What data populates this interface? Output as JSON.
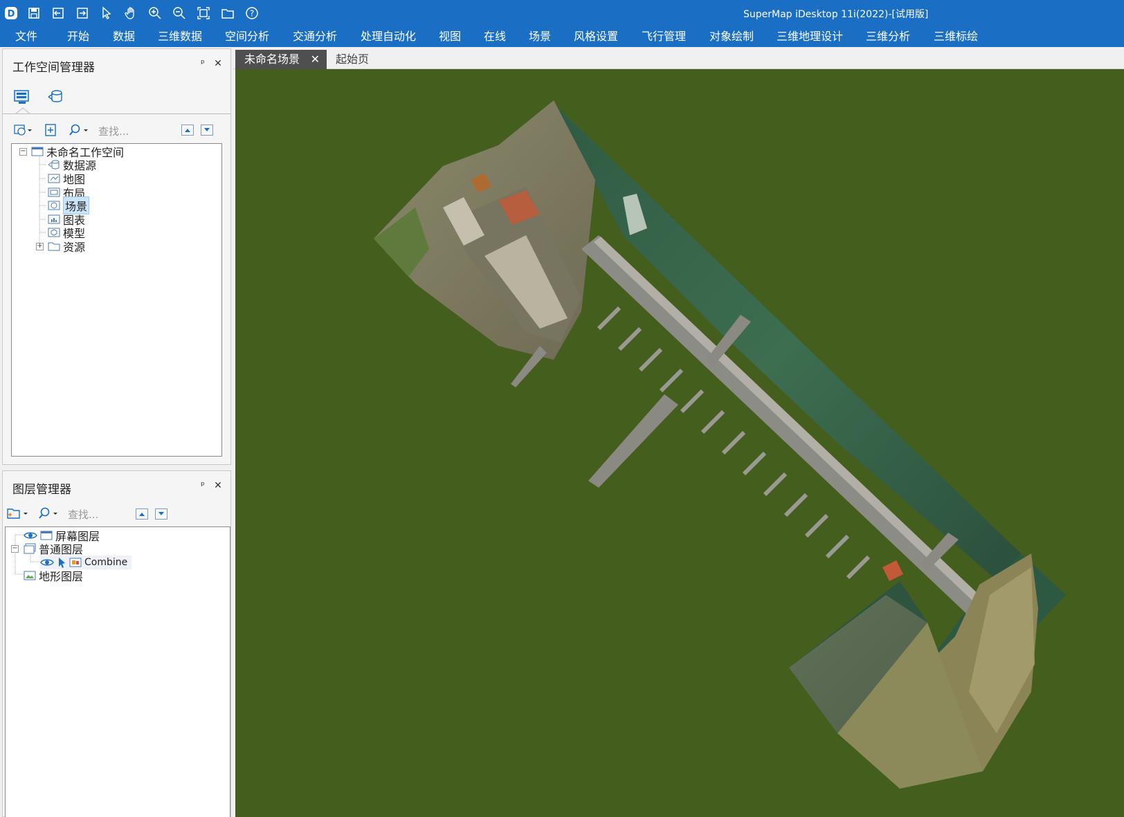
{
  "app": {
    "title": "SuperMap iDesktop 11i(2022)-[试用版]",
    "logo_icon": "app-logo-icon",
    "quick_access": [
      "save-icon",
      "import-icon",
      "export-icon",
      "select-icon",
      "pan-icon",
      "zoom-in-icon",
      "zoom-out-icon",
      "full-extent-icon",
      "open-folder-icon",
      "help-icon"
    ]
  },
  "menubar": {
    "items": [
      "文件",
      "开始",
      "数据",
      "三维数据",
      "空间分析",
      "交通分析",
      "处理自动化",
      "视图",
      "在线",
      "场景",
      "风格设置",
      "飞行管理",
      "对象绘制",
      "三维地理设计",
      "三维分析",
      "三维标绘"
    ],
    "active": "场景"
  },
  "workspace_panel": {
    "title": "工作空间管理器",
    "pin": "ᵖ",
    "close": "✕",
    "search_placeholder": "查找...",
    "tree": {
      "root": "未命名工作空间",
      "children": [
        "数据源",
        "地图",
        "布局",
        "场景",
        "图表",
        "模型",
        "资源"
      ],
      "selected": "场景"
    }
  },
  "layer_panel": {
    "title": "图层管理器",
    "pin": "ᵖ",
    "close": "✕",
    "search_placeholder": "查找...",
    "tree": {
      "screen_layer": "屏幕图层",
      "normal_layer": "普通图层",
      "combine": "Combine",
      "terrain_layer": "地形图层"
    }
  },
  "tabs": {
    "active": "未命名场景",
    "close": "✕",
    "start": "起始页"
  },
  "colors": {
    "title_bar": "#1a6fc4",
    "scene_bg": "#445e1e",
    "active_tab": "#4f4f4f",
    "selection": "#cce4f7"
  }
}
